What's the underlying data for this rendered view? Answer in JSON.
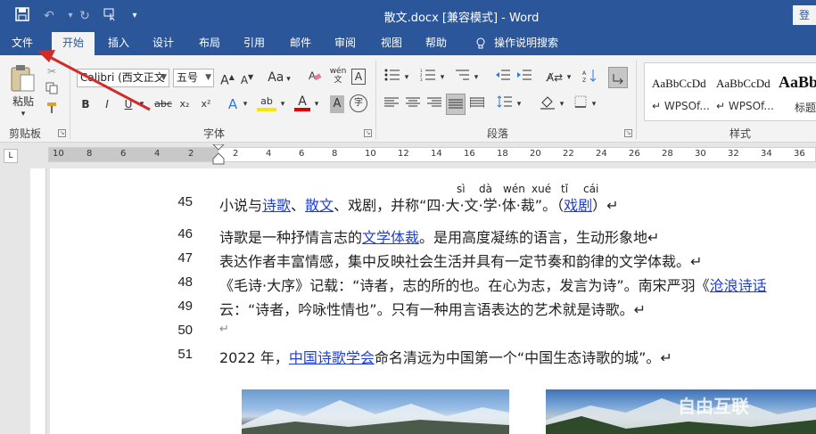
{
  "titlebar": {
    "title": "散文.docx [兼容模式] - Word",
    "login_label": "登",
    "qa_save_icon": "save-icon",
    "qa_undo_icon": "undo-icon",
    "qa_redo_icon": "redo-icon",
    "qa_touch_icon": "touch-mode-icon",
    "qa_customize_icon": "customize-quick-access-icon"
  },
  "tabs": [
    {
      "label": "文件"
    },
    {
      "label": "开始"
    },
    {
      "label": "插入"
    },
    {
      "label": "设计"
    },
    {
      "label": "布局"
    },
    {
      "label": "引用"
    },
    {
      "label": "邮件"
    },
    {
      "label": "审阅"
    },
    {
      "label": "视图"
    },
    {
      "label": "帮助"
    },
    {
      "label": "操作说明搜索"
    }
  ],
  "ribbon": {
    "clipboard": {
      "paste_label": "粘贴",
      "group_label": "剪贴板"
    },
    "font": {
      "font_name": "Calibri (西文正文",
      "font_size": "五号",
      "change_case_label": "Aa",
      "phonetic_label": "wén",
      "bold": "B",
      "italic": "I",
      "underline": "U",
      "strike": "abc",
      "subscript": "x₂",
      "superscript": "x²",
      "text_effect": "A",
      "highlight": "ab",
      "font_color": "A",
      "char_shading": "A",
      "enclose": "字",
      "grow_label": "A",
      "shrink_label": "A",
      "group_label": "字体"
    },
    "paragraph": {
      "group_label": "段落"
    },
    "styles": {
      "items": [
        {
          "sample": "AaBbCcDd",
          "name": "WPSOf..."
        },
        {
          "sample": "AaBbCcDd",
          "name": "WPSOf..."
        },
        {
          "sample": "AaBbl",
          "name": "标题"
        }
      ],
      "group_label": "样式"
    }
  },
  "ruler": {
    "numbers": [
      "10",
      "8",
      "6",
      "4",
      "2",
      "2",
      "4",
      "6",
      "8",
      "10",
      "12",
      "14",
      "16",
      "18",
      "20",
      "22",
      "24",
      "26",
      "28",
      "30",
      "32",
      "34",
      "36",
      "38"
    ],
    "tab_selector": "L"
  },
  "document": {
    "line45": {
      "num": "45",
      "pre": "小说与",
      "link1": "诗歌",
      "sep1": "、",
      "link2": "散文",
      "post": "、戏剧，并称“四·大·文·学·体·裁”。（",
      "link3": "戏剧",
      "end": "）↵",
      "ruby": [
        "sì",
        "dà",
        "wén",
        "xué",
        "tǐ",
        "cái"
      ]
    },
    "line46": {
      "num": "46",
      "pre": "诗歌是一种抒情言志的",
      "link": "文学体裁",
      "post": "。是用高度凝练的语言，生动形象地↵"
    },
    "line47": {
      "num": "47",
      "text": "表达作者丰富情感，集中反映社会生活并具有一定节奏和韵律的文学体裁。↵"
    },
    "line48": {
      "num": "48",
      "pre": "《毛诗·大序》记载：“诗者，志的所的也。在心为志，发言为诗”。南宋严羽《",
      "link": "沧浪诗话"
    },
    "line49": {
      "num": "49",
      "text": "云：“诗者，吟咏性情也”。只有一种用言语表达的艺术就是诗歌。↵"
    },
    "line50": {
      "num": "50",
      "text": "↵"
    },
    "line51": {
      "num": "51",
      "pre": "2022 年，",
      "link": "中国诗歌学会",
      "post": "命名清远为中国第一个“中国生态诗歌的城”。↵"
    }
  },
  "watermark": "自由互联",
  "colors": {
    "accent": "#2b579a",
    "link": "#1f3fd4",
    "arrow": "#d22b2b"
  }
}
